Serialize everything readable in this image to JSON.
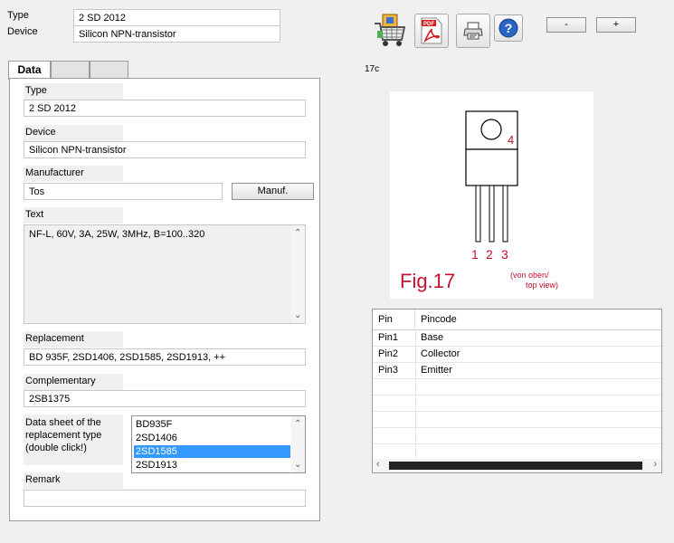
{
  "header": {
    "type_label": "Type",
    "type_value": "2 SD 2012",
    "device_label": "Device",
    "device_value": "Silicon NPN-transistor"
  },
  "toolbar": {
    "icons": [
      "shopping-cart-icon",
      "pdf-icon",
      "printer-icon",
      "help-icon"
    ],
    "minus_label": "-",
    "plus_label": "+"
  },
  "tabs": [
    {
      "label": "Data",
      "active": true
    },
    {
      "label": "",
      "active": false
    },
    {
      "label": "",
      "active": false
    }
  ],
  "form": {
    "type_label": "Type",
    "type_value": "2 SD 2012",
    "device_label": "Device",
    "device_value": "Silicon NPN-transistor",
    "manufacturer_label": "Manufacturer",
    "manufacturer_value": "Tos",
    "manuf_button": "Manuf.",
    "text_label": "Text",
    "text_value": "NF-L, 60V, 3A, 25W, 3MHz, B=100..320",
    "replacement_label": "Replacement",
    "replacement_value": "BD 935F, 2SD1406, 2SD1585, 2SD1913, ++",
    "complementary_label": "Complementary",
    "complementary_value": "2SB1375",
    "datasheet_label": "Data sheet of the replacement type (double click!)",
    "datasheet_items": [
      "BD935F",
      "2SD1406",
      "2SD1585",
      "2SD1913"
    ],
    "datasheet_selected": "2SD1585",
    "remark_label": "Remark",
    "remark_value": ""
  },
  "package": {
    "code": "17c",
    "pin_numbers": [
      "1",
      "2",
      "3"
    ],
    "tab_pin": "4",
    "figure_label": "Fig.17",
    "view_note_line1": "(von oben/",
    "view_note_line2": "top view)"
  },
  "pins": {
    "headers": [
      "Pin",
      "Pincode"
    ],
    "rows": [
      [
        "Pin1",
        "Base"
      ],
      [
        "Pin2",
        "Collector"
      ],
      [
        "Pin3",
        "Emitter"
      ]
    ]
  },
  "colors": {
    "selection": "#3399ff",
    "figure_red": "#c8102e",
    "background": "#f0f0f0"
  }
}
